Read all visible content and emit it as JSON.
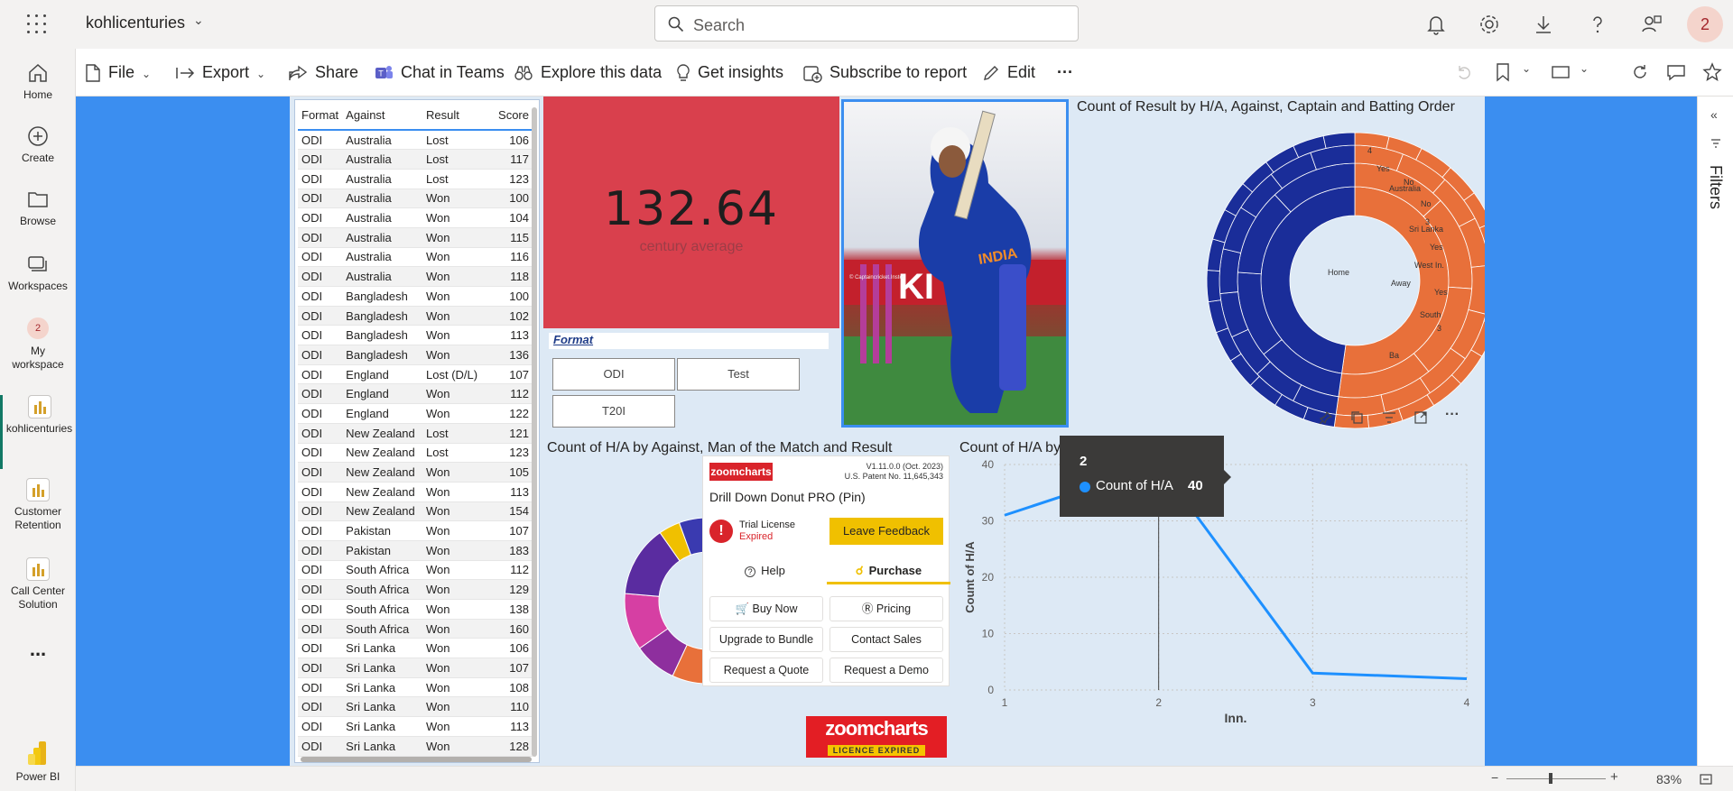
{
  "app": {
    "title": "kohlicenturies"
  },
  "search": {
    "placeholder": "Search"
  },
  "avatar": {
    "initial": "2"
  },
  "nav": {
    "home": "Home",
    "create": "Create",
    "browse": "Browse",
    "workspaces": "Workspaces",
    "my_workspace_badge": "2",
    "my_workspace": "My workspace",
    "kohlicenturies": "kohlicenturies",
    "customer_retention": "Customer Retention",
    "call_center": "Call Center Solution",
    "more": "...",
    "powerbi": "Power BI"
  },
  "toolbar": {
    "file": "File",
    "export": "Export",
    "share": "Share",
    "chat": "Chat in Teams",
    "explore": "Explore this data",
    "insights": "Get insights",
    "subscribe": "Subscribe to report",
    "edit": "Edit",
    "more": "···"
  },
  "filters": {
    "label": "Filters"
  },
  "table": {
    "headers": [
      "Format",
      "Against",
      "Result",
      "Score"
    ],
    "rows": [
      [
        "ODI",
        "Australia",
        "Lost",
        "106"
      ],
      [
        "ODI",
        "Australia",
        "Lost",
        "117"
      ],
      [
        "ODI",
        "Australia",
        "Lost",
        "123"
      ],
      [
        "ODI",
        "Australia",
        "Won",
        "100"
      ],
      [
        "ODI",
        "Australia",
        "Won",
        "104"
      ],
      [
        "ODI",
        "Australia",
        "Won",
        "115"
      ],
      [
        "ODI",
        "Australia",
        "Won",
        "116"
      ],
      [
        "ODI",
        "Australia",
        "Won",
        "118"
      ],
      [
        "ODI",
        "Bangladesh",
        "Won",
        "100"
      ],
      [
        "ODI",
        "Bangladesh",
        "Won",
        "102"
      ],
      [
        "ODI",
        "Bangladesh",
        "Won",
        "113"
      ],
      [
        "ODI",
        "Bangladesh",
        "Won",
        "136"
      ],
      [
        "ODI",
        "England",
        "Lost (D/L)",
        "107"
      ],
      [
        "ODI",
        "England",
        "Won",
        "112"
      ],
      [
        "ODI",
        "England",
        "Won",
        "122"
      ],
      [
        "ODI",
        "New Zealand",
        "Lost",
        "121"
      ],
      [
        "ODI",
        "New Zealand",
        "Lost",
        "123"
      ],
      [
        "ODI",
        "New Zealand",
        "Won",
        "105"
      ],
      [
        "ODI",
        "New Zealand",
        "Won",
        "113"
      ],
      [
        "ODI",
        "New Zealand",
        "Won",
        "154"
      ],
      [
        "ODI",
        "Pakistan",
        "Won",
        "107"
      ],
      [
        "ODI",
        "Pakistan",
        "Won",
        "183"
      ],
      [
        "ODI",
        "South Africa",
        "Won",
        "112"
      ],
      [
        "ODI",
        "South Africa",
        "Won",
        "129"
      ],
      [
        "ODI",
        "South Africa",
        "Won",
        "138"
      ],
      [
        "ODI",
        "South Africa",
        "Won",
        "160"
      ],
      [
        "ODI",
        "Sri Lanka",
        "Won",
        "106"
      ],
      [
        "ODI",
        "Sri Lanka",
        "Won",
        "107"
      ],
      [
        "ODI",
        "Sri Lanka",
        "Won",
        "108"
      ],
      [
        "ODI",
        "Sri Lanka",
        "Won",
        "110"
      ],
      [
        "ODI",
        "Sri Lanka",
        "Won",
        "113"
      ],
      [
        "ODI",
        "Sri Lanka",
        "Won",
        "128"
      ]
    ]
  },
  "card": {
    "value": "132.64",
    "label": "century average"
  },
  "slicer": {
    "title": "Format",
    "options": [
      "ODI",
      "Test",
      "T20I"
    ]
  },
  "photo": {
    "watermark": "© Captaincricket.Inster",
    "jersey": "INDIA",
    "board": "KI"
  },
  "sunburst": {
    "title": "Count of Result by H/A, Against, Captain and Batting Order",
    "colors": {
      "away": "#e8703a",
      "home": "#1a2d99"
    },
    "labels": [
      "4",
      "Yes",
      "No",
      "Australia",
      "No",
      "3",
      "Sri Lanka",
      "Yes",
      "West In.",
      "Away",
      "Yes",
      "South",
      "3",
      "Ba",
      "Home"
    ]
  },
  "donut": {
    "title": "Count of H/A by Against, Man of the Match and Result",
    "colors": [
      "#e8703a",
      "#8e2f9e",
      "#d63fa3",
      "#5a2ca0",
      "#f0c000",
      "#3a3ab0"
    ]
  },
  "zoomcharts": {
    "logo": "zoomcharts",
    "version": "V1.11.0.0 (Oct. 2023)",
    "patent": "U.S. Patent No. 11,645,343",
    "product": "Drill Down Donut PRO (Pin)",
    "trial": "Trial License",
    "expired": "Expired",
    "feedback": "Leave Feedback",
    "tab_help": "Help",
    "tab_purchase": "Purchase",
    "buttons": [
      "Buy Now",
      "Pricing",
      "Upgrade to Bundle",
      "Contact Sales",
      "Request a Quote",
      "Request a Demo"
    ],
    "badge_main": "zoomcharts",
    "badge_sub": "LICENCE EXPIRED"
  },
  "chart_data": {
    "type": "line",
    "title": "Count of H/A by Inn.",
    "xlabel": "Inn.",
    "ylabel": "Count of H/A",
    "x": [
      1,
      2,
      3,
      4
    ],
    "series": [
      {
        "values": [
          31,
          40,
          3,
          2
        ]
      }
    ],
    "ylim": [
      0,
      40
    ],
    "yticks": [
      0,
      10,
      20,
      30,
      40
    ],
    "color": "#1e90ff",
    "grid": true
  },
  "tooltip": {
    "title": "2",
    "label": "Count of H/A",
    "value": "40"
  },
  "status": {
    "zoom": "83%"
  }
}
